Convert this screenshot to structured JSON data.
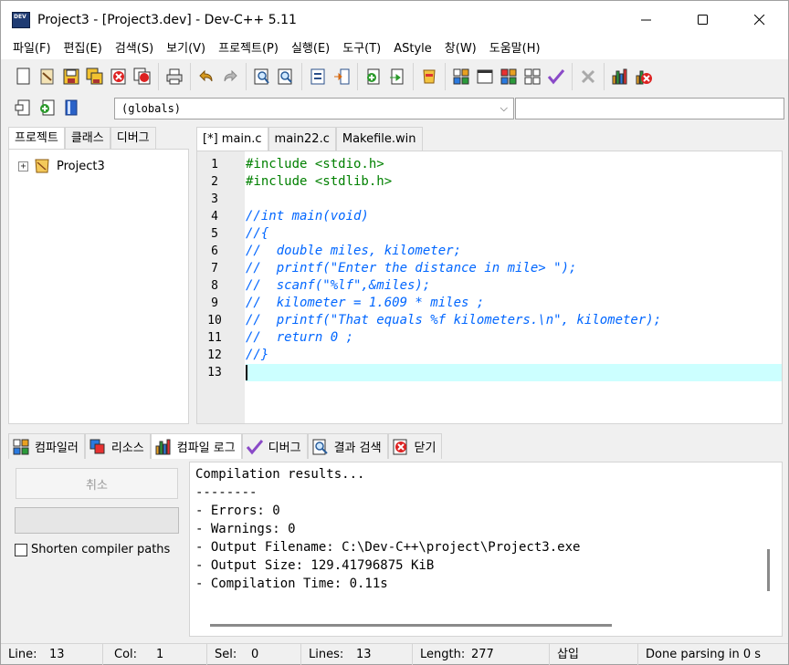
{
  "window": {
    "title": "Project3 - [Project3.dev] - Dev-C++ 5.11",
    "minimize_icon": "minimize-icon",
    "maximize_icon": "maximize-icon",
    "close_icon": "close-icon"
  },
  "menu": [
    "파일(F)",
    "편집(E)",
    "검색(S)",
    "보기(V)",
    "프로젝트(P)",
    "실행(E)",
    "도구(T)",
    "AStyle",
    "창(W)",
    "도움말(H)"
  ],
  "toolbar": {
    "scope_value": "(globals)",
    "scope_arrow": "⌵"
  },
  "left_tabs": [
    "프로젝트",
    "클래스",
    "디버그"
  ],
  "project_tree": {
    "expander": "+",
    "root": "Project3"
  },
  "editor_tabs": [
    "[*] main.c",
    "main22.c",
    "Makefile.win"
  ],
  "code_lines": [
    {
      "n": "1",
      "text": "#include <stdio.h>",
      "kind": "pp"
    },
    {
      "n": "2",
      "text": "#include <stdlib.h>",
      "kind": "pp"
    },
    {
      "n": "3",
      "text": "",
      "kind": "pp"
    },
    {
      "n": "4",
      "text": "//int main(void)",
      "kind": "cm"
    },
    {
      "n": "5",
      "text": "//{",
      "kind": "cm"
    },
    {
      "n": "6",
      "text": "//  double miles, kilometer;",
      "kind": "cm"
    },
    {
      "n": "7",
      "text": "//  printf(\"Enter the distance in mile> \");",
      "kind": "cm"
    },
    {
      "n": "8",
      "text": "//  scanf(\"%lf\",&miles);",
      "kind": "cm"
    },
    {
      "n": "9",
      "text": "//  kilometer = 1.609 * miles ;",
      "kind": "cm"
    },
    {
      "n": "10",
      "text": "//  printf(\"That equals %f kilometers.\\n\", kilometer);",
      "kind": "cm"
    },
    {
      "n": "11",
      "text": "//  return 0 ;",
      "kind": "cm"
    },
    {
      "n": "12",
      "text": "//}",
      "kind": "cm"
    },
    {
      "n": "13",
      "text": "",
      "kind": "pp"
    }
  ],
  "bottom_tabs": [
    {
      "label": "컴파일러",
      "icon": "compiler-grid-icon"
    },
    {
      "label": "리소스",
      "icon": "resources-icon"
    },
    {
      "label": "컴파일 로그",
      "icon": "compile-log-chart-icon"
    },
    {
      "label": "디버그",
      "icon": "debug-check-icon"
    },
    {
      "label": "결과 검색",
      "icon": "find-results-icon"
    },
    {
      "label": "닫기",
      "icon": "close-panel-icon"
    }
  ],
  "compile_panel": {
    "cancel_label": "취소",
    "shorten_label": "Shorten compiler paths"
  },
  "log_lines": [
    "Compilation results...",
    "--------",
    "- Errors: 0",
    "- Warnings: 0",
    "- Output Filename: C:\\Dev-C++\\project\\Project3.exe",
    "- Output Size: 129.41796875 KiB",
    "- Compilation Time: 0.11s"
  ],
  "status": {
    "line_label": "Line:",
    "line_value": "13",
    "col_label": "Col:",
    "col_value": "1",
    "sel_label": "Sel:",
    "sel_value": "0",
    "lines_label": "Lines:",
    "lines_value": "13",
    "length_label": "Length:",
    "length_value": "277",
    "mode": "삽입",
    "parse_status": "Done parsing in 0 s"
  }
}
